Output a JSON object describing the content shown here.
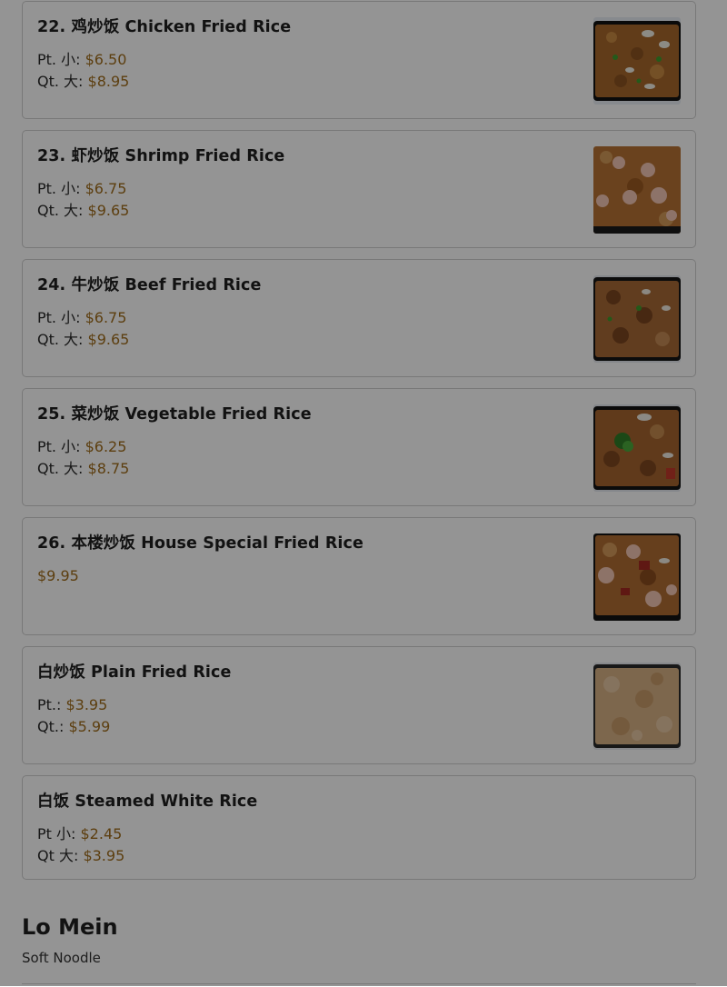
{
  "menu_items": [
    {
      "title": "22. 鸡炒饭 Chicken Fried Rice",
      "prices": [
        {
          "label": "Pt. 小: ",
          "value": "$6.50"
        },
        {
          "label": "Qt. 大: ",
          "value": "$8.95"
        }
      ],
      "image": "chicken-fried-rice-photo"
    },
    {
      "title": "23. 虾炒饭 Shrimp Fried Rice",
      "prices": [
        {
          "label": "Pt. 小: ",
          "value": "$6.75"
        },
        {
          "label": "Qt. 大: ",
          "value": "$9.65"
        }
      ],
      "image": "shrimp-fried-rice-photo"
    },
    {
      "title": "24. 牛炒饭 Beef Fried Rice",
      "prices": [
        {
          "label": "Pt. 小: ",
          "value": "$6.75"
        },
        {
          "label": "Qt. 大: ",
          "value": "$9.65"
        }
      ],
      "image": "beef-fried-rice-photo"
    },
    {
      "title": "25. 菜炒饭 Vegetable Fried Rice",
      "prices": [
        {
          "label": "Pt. 小: ",
          "value": "$6.25"
        },
        {
          "label": "Qt. 大: ",
          "value": "$8.75"
        }
      ],
      "image": "vegetable-fried-rice-photo"
    },
    {
      "title": "26. 本楼炒饭 House Special Fried Rice",
      "prices": [
        {
          "label": "",
          "value": "$9.95"
        }
      ],
      "image": "house-special-fried-rice-photo"
    },
    {
      "title": "白炒饭 Plain Fried Rice",
      "prices": [
        {
          "label": "Pt.: ",
          "value": "$3.95"
        },
        {
          "label": "Qt.: ",
          "value": "$5.99"
        }
      ],
      "image": "plain-fried-rice-photo"
    },
    {
      "title": "白饭 Steamed White Rice",
      "prices": [
        {
          "label": "Pt 小: ",
          "value": "$2.45"
        },
        {
          "label": "Qt 大: ",
          "value": "$3.95"
        }
      ],
      "image": ""
    }
  ],
  "section": {
    "title": "Lo Mein",
    "subtitle": "Soft Noodle"
  },
  "colors": {
    "price": "#a06d1c",
    "overlay": "rgba(0,0,0,0.42)"
  }
}
